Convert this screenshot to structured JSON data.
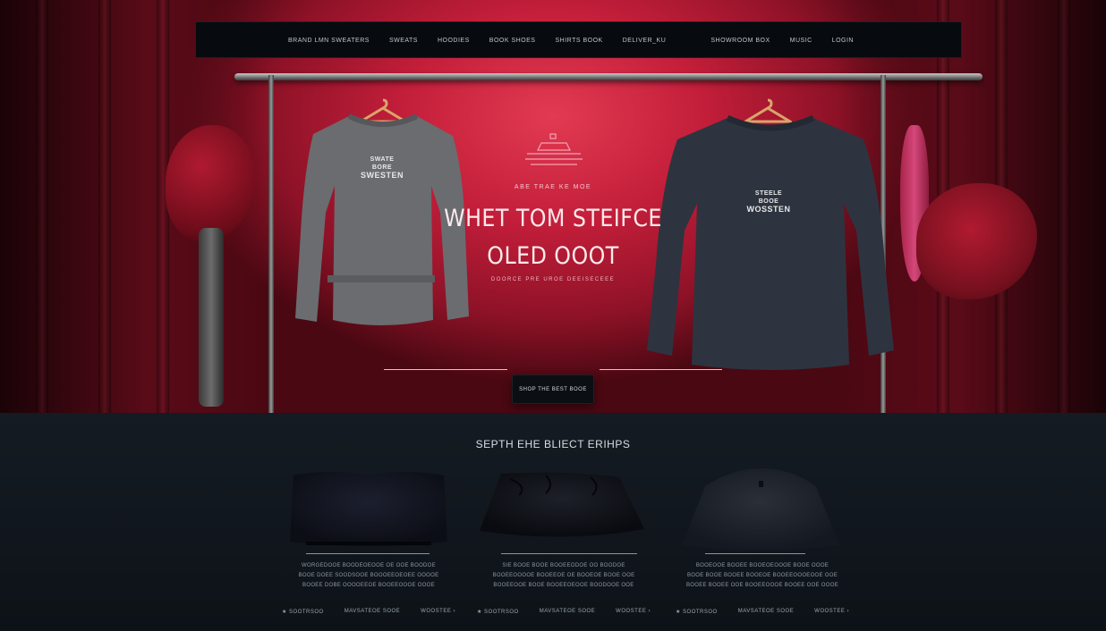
{
  "nav": {
    "left_links": [
      "BRAND LMN SWEATERS",
      "SWEATS",
      "HOODIES",
      "BOOK SHOES",
      "SHIRTS BOOK",
      "DELIVER_KU"
    ],
    "right_links": [
      "SHOWROOM BOX",
      "MUSIC",
      "LOGIN"
    ]
  },
  "hero": {
    "eyebrow": "ABE TRAE KE MOE",
    "headline_line1": "WHET TOM STEIFCE",
    "headline_line2": "OLED OOOT",
    "subline": "DOORCE PRE UROE DEEISECEEE",
    "cta_label": "SHOP THE BEST BOOE",
    "left_shirt_text": [
      "SWATE",
      "BORE",
      "SWESTEN"
    ],
    "right_shirt_text": [
      "STEELE",
      "BOOE",
      "WOSSTEN"
    ]
  },
  "section": {
    "title": "SEPTH EHE BLIECT ERIHPS",
    "products": [
      {
        "desc_lines": [
          "WORGEDOOE BOODEOEOOE OE OOE BOODOE",
          "BOOE DOEE SOODSOOE BOOOEEOEOEE OOOOE",
          "BOOEE DOBE OOOOEEOE BOOEEOOOE OOOE"
        ],
        "rating": "★ SOOTRSOO",
        "stock": "MAVSATEOE SOOE",
        "more": "WOOSTEE ›"
      },
      {
        "desc_lines": [
          "SIE BOOE BOOE BOOEEODOE OO BOODOE",
          "BOOEEOOOOE BOOEEOE OE BOOEOE BOOE OOE",
          "BOOEEOOE BOOE BOOEEOEOOE BOODOOE OOE"
        ],
        "rating": "★ SOOTRSOO",
        "stock": "MAVSATEOE SOOE",
        "more": "WOOSTEE ›"
      },
      {
        "desc_lines": [
          "BOOEOOE BOOEE BOOEOEOOOE BOOE OOOE",
          "BOOE BOOE BOOEE BOOEOE BOOEEOOOEOOE OOE",
          "BOOEE BOOEE OOE BOOEEOOOE BOOEE OOE OOOE"
        ],
        "rating": "★ SOOTRSOO",
        "stock": "MAVSATEOE SOOE",
        "more": "WOOSTEE ›"
      }
    ]
  },
  "colors": {
    "hero_red": "#c31e3a",
    "nav_bg": "#070a0e",
    "section_bg": "#10161c"
  }
}
